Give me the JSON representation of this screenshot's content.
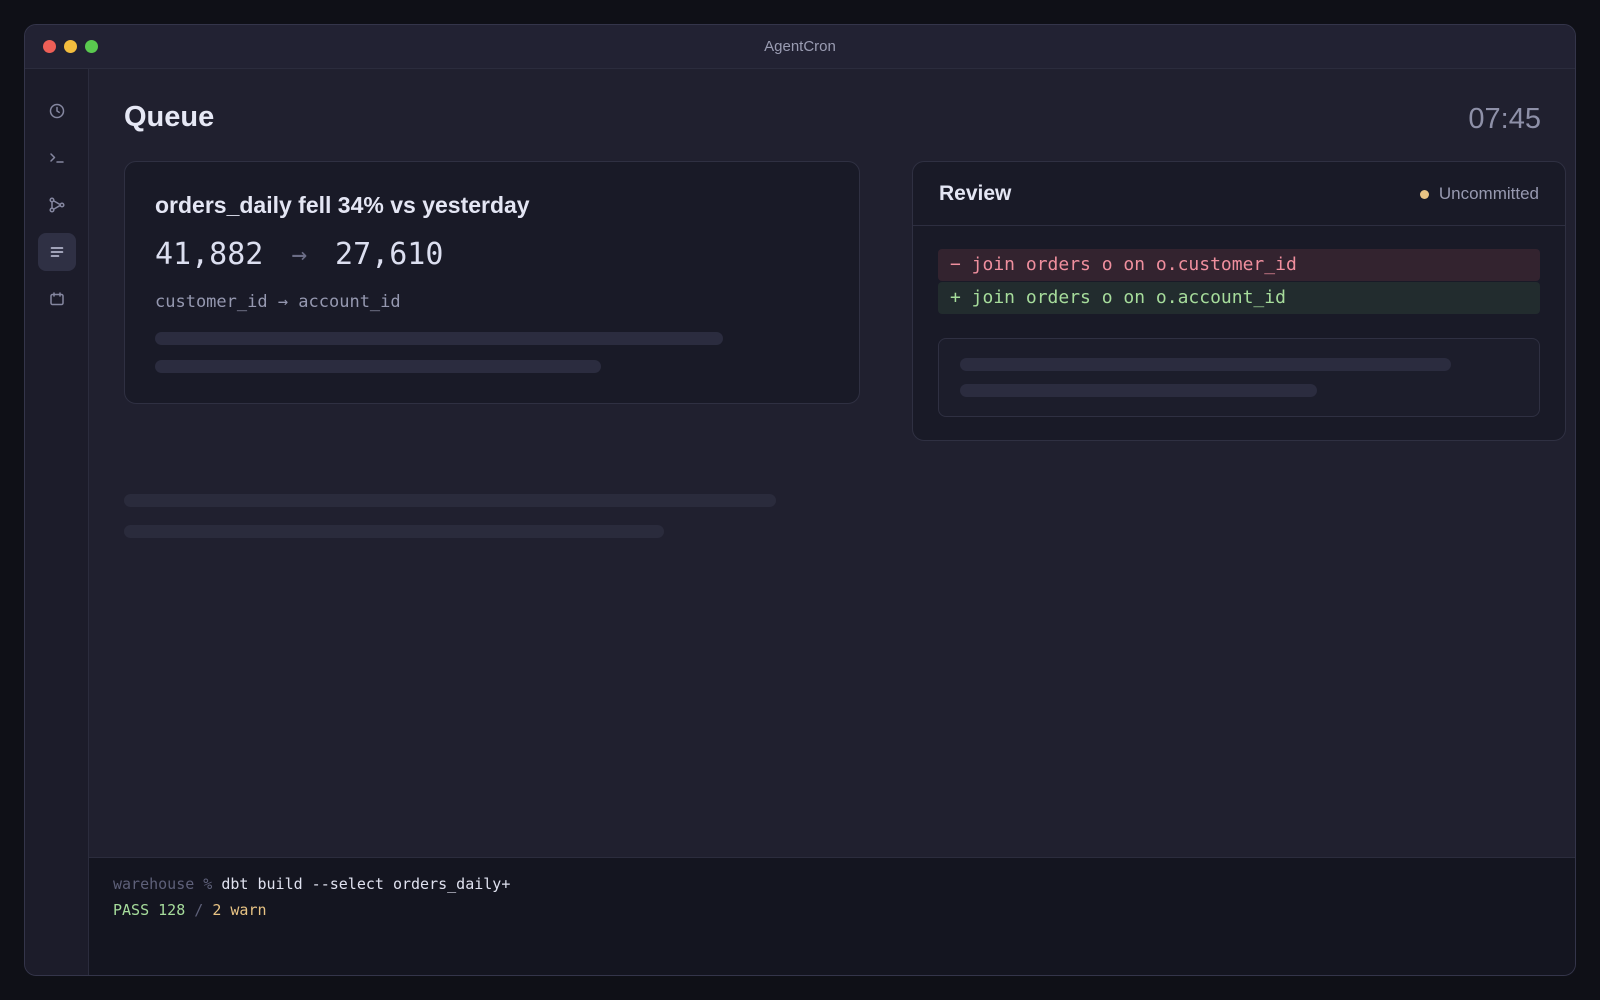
{
  "window": {
    "title": "AgentCron"
  },
  "sidebar": {
    "items": [
      {
        "icon": "clock-icon",
        "active": false
      },
      {
        "icon": "terminal-icon",
        "active": false
      },
      {
        "icon": "git-branch-icon",
        "active": false
      },
      {
        "icon": "list-icon",
        "active": true
      },
      {
        "icon": "calendar-icon",
        "active": false
      }
    ]
  },
  "header": {
    "title": "Queue",
    "time": "07:45"
  },
  "alert": {
    "title": "orders_daily fell 34% vs yesterday",
    "from_value": "41,882",
    "arrow": "→",
    "to_value": "27,610",
    "subtitle": "customer_id → account_id"
  },
  "review": {
    "title": "Review",
    "status": "Uncommitted",
    "status_color": "#e8c384",
    "diff": {
      "removed": "− join orders o on o.customer_id",
      "added": "+ join orders o on o.account_id"
    }
  },
  "terminal": {
    "prompt": "warehouse % ",
    "command": "dbt build --select orders_daily+",
    "pass": "PASS 128",
    "separator": " / ",
    "warn": "2 warn"
  },
  "colors": {
    "background": "#20202f",
    "removed": "#f08f9e",
    "added": "#a6dc9b",
    "warn": "#e8c384"
  }
}
